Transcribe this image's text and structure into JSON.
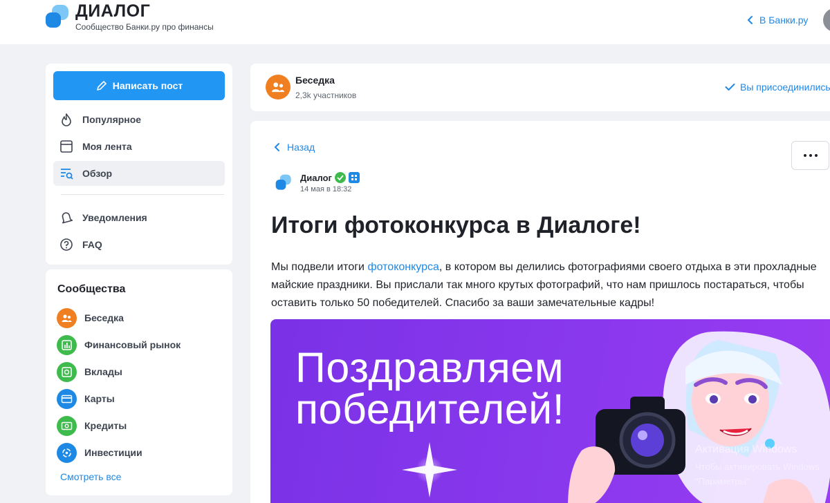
{
  "header": {
    "brand": "ДИАЛОГ",
    "tagline": "Сообщество Банки.ру про финансы",
    "back_link": "В Банки.ру"
  },
  "sidebar": {
    "write_button": "Написать пост",
    "nav": [
      {
        "label": "Популярное",
        "icon": "fire-icon"
      },
      {
        "label": "Моя лента",
        "icon": "feed-icon"
      },
      {
        "label": "Обзор",
        "icon": "browse-icon",
        "active": true
      },
      {
        "label": "Уведомления",
        "icon": "bell-icon"
      },
      {
        "label": "FAQ",
        "icon": "question-icon"
      }
    ],
    "communities_title": "Сообщества",
    "communities": [
      {
        "label": "Беседка",
        "icon": "people-icon",
        "color": "#f07f22"
      },
      {
        "label": "Финансовый рынок",
        "icon": "bar-chart-icon",
        "color": "#3fbb4d"
      },
      {
        "label": "Вклады",
        "icon": "safe-icon",
        "color": "#3fbb4d"
      },
      {
        "label": "Карты",
        "icon": "card-icon",
        "color": "#1e88e5"
      },
      {
        "label": "Кредиты",
        "icon": "loan-icon",
        "color": "#3fbb4d"
      },
      {
        "label": "Инвестиции",
        "icon": "invest-icon",
        "color": "#1e88e5"
      }
    ],
    "see_all": "Смотреть все"
  },
  "group": {
    "name": "Беседка",
    "members": "2,3k участников",
    "joined": "Вы присоединились"
  },
  "post": {
    "back": "Назад",
    "author": "Диалог",
    "date": "14 мая в 18:32",
    "title": "Итоги фотоконкурса в Диалоге!",
    "text_before": "Мы подвели итоги ",
    "text_link": "фотоконкурса",
    "text_after": ", в котором вы делились фотографиями своего отдыха в эти прохладные майские праздники. Вы прислали так много крутых фотографий, что нам пришлось постараться, чтобы оставить только 50 победителей. Спасибо за ваши замечательные кадры!",
    "banner_line1": "Поздравляем",
    "banner_line2": "победителей!"
  },
  "watermark": {
    "title": "Активация Windows",
    "line1": "Чтобы активировать Windows",
    "line2": "\"Параметры\"."
  },
  "colors": {
    "accent": "#2196f3",
    "link": "#1e88e5",
    "banner": "#8a38ee"
  }
}
